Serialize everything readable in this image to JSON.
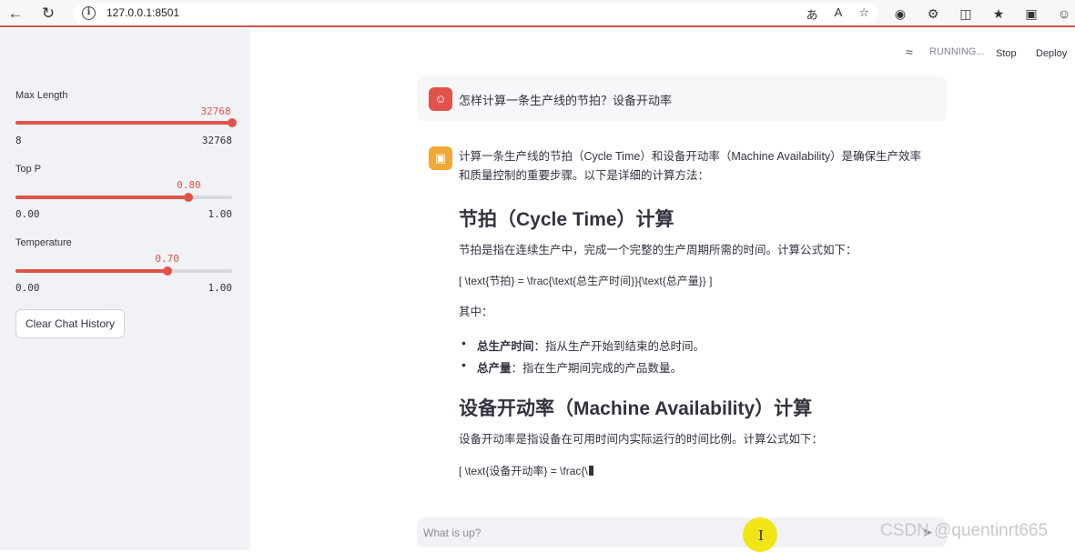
{
  "browser": {
    "url": "127.0.0.1:8501",
    "back_icon": "arrow-left",
    "reload_icon": "reload",
    "info_icon": "info-circle"
  },
  "sidebar": {
    "sliders": [
      {
        "label": "Max Length",
        "value": "32768",
        "min": "8",
        "max": "32768",
        "fraction": 1.0
      },
      {
        "label": "Top P",
        "value": "0.80",
        "min": "0.00",
        "max": "1.00",
        "fraction": 0.8
      },
      {
        "label": "Temperature",
        "value": "0.70",
        "min": "0.00",
        "max": "1.00",
        "fraction": 0.7
      }
    ],
    "clear_button": "Clear Chat History"
  },
  "header": {
    "status": "RUNNING...",
    "stop": "Stop",
    "deploy": "Deploy"
  },
  "chat": {
    "user_message": "怎样计算一条生产线的节拍？设备开动率",
    "answer": {
      "intro_line1": "计算一条生产线的节拍（Cycle Time）和设备开动率（Machine Availability）是确保生产效率",
      "intro_line2": "和质量控制的重要步骤。以下是详细的计算方法：",
      "h1": "节拍（Cycle Time）计算",
      "p1": "节拍是指在连续生产中，完成一个完整的生产周期所需的时间。计算公式如下：",
      "formula1": "[ \\text{节拍} = \\frac{\\text{总生产时间}}{\\text{总产量}} ]",
      "among": "其中：",
      "bullet1_bold": "总生产时间",
      "bullet1_text": "：指从生产开始到结束的总时间。",
      "bullet2_bold": "总产量",
      "bullet2_text": "：指在生产期间完成的产品数量。",
      "h2": "设备开动率（Machine Availability）计算",
      "p2": "设备开动率是指设备在可用时间内实际运行的时间比例。计算公式如下：",
      "formula2": "[ \\text{设备开动率} = \\frac{\\"
    },
    "input_placeholder": "What is up?"
  },
  "watermark": "CSDN @quentinrt665",
  "colors": {
    "accent": "#e0534a",
    "sidebar_bg": "#f0f2f6",
    "bot_avatar": "#f0a839"
  }
}
